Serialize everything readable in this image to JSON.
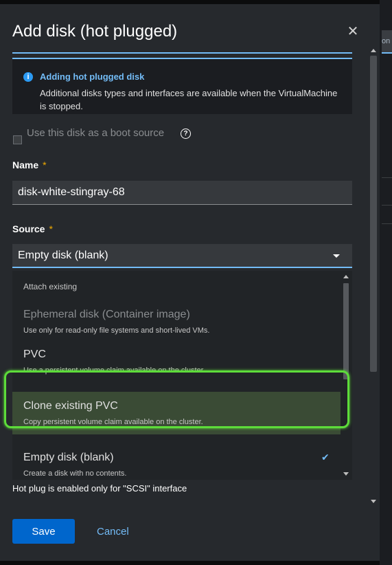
{
  "modal": {
    "title": "Add disk (hot plugged)",
    "close_icon": "close-icon"
  },
  "alert": {
    "icon": "info-icon",
    "title": "Adding hot plugged disk",
    "body": "Additional disks types and interfaces are available when the VirtualMachine is stopped."
  },
  "boot": {
    "label": "Use this disk as a boot source",
    "checked": false,
    "help_icon": "help-icon"
  },
  "name_field": {
    "label": "Name",
    "required_mark": "*",
    "value": "disk-white-stingray-68"
  },
  "source_field": {
    "label": "Source",
    "required_mark": "*",
    "selected": "Empty disk (blank)"
  },
  "menu": {
    "group_title": "Attach existing",
    "options": [
      {
        "label": "Ephemeral disk (Container image)",
        "description": "Use only for read-only file systems and short-lived VMs.",
        "disabled": true
      },
      {
        "label": "PVC",
        "description": "Use a persistent volume claim available on the cluster."
      },
      {
        "label": "Clone existing PVC",
        "description": "Copy persistent volume claim available on the cluster.",
        "hovered": true
      },
      {
        "label": "Empty disk (blank)",
        "description": "Create a disk with no contents.",
        "selected": true
      }
    ]
  },
  "hint": "Hot plug is enabled only for \"SCSI\" interface",
  "footer": {
    "save_label": "Save",
    "cancel_label": "Cancel"
  },
  "colors": {
    "accent": "#73bcf7",
    "primary_button": "#0066cc",
    "required": "#f0ab00",
    "highlight": "#5ddc3a"
  }
}
